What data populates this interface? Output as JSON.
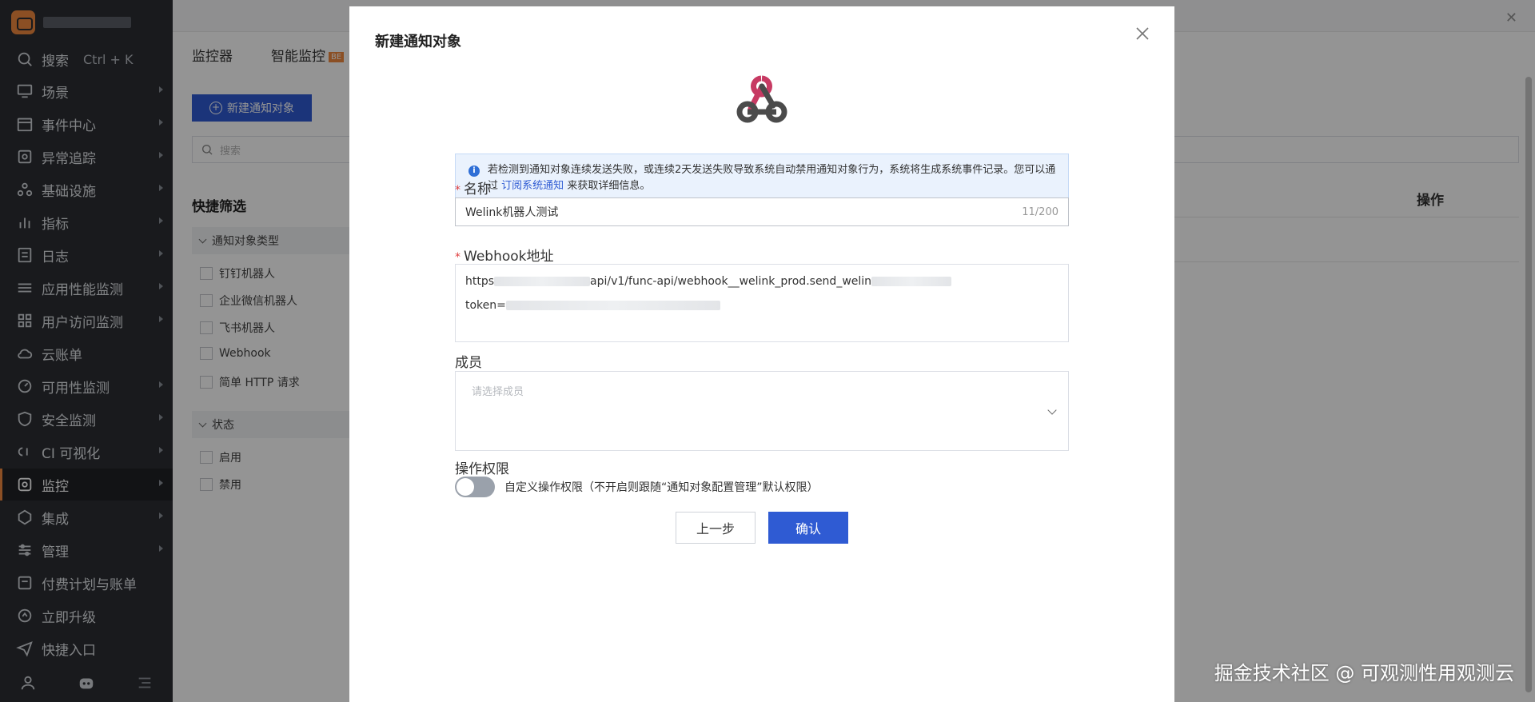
{
  "sidebar": {
    "search": {
      "label": "搜索",
      "shortcut": "Ctrl + K"
    },
    "items": [
      {
        "label": "场景",
        "icon": "monitor-icon"
      },
      {
        "label": "事件中心",
        "icon": "calendar-icon"
      },
      {
        "label": "异常追踪",
        "icon": "target-icon"
      },
      {
        "label": "基础设施",
        "icon": "nodes-icon"
      },
      {
        "label": "指标",
        "icon": "chart-icon"
      },
      {
        "label": "日志",
        "icon": "log-icon"
      },
      {
        "label": "应用性能监测",
        "icon": "sliders-icon"
      },
      {
        "label": "用户访问监测",
        "icon": "grid-icon"
      },
      {
        "label": "云账单",
        "icon": "cloud-icon"
      },
      {
        "label": "可用性监测",
        "icon": "gauge-icon"
      },
      {
        "label": "安全监测",
        "icon": "shield-icon"
      },
      {
        "label": "CI 可视化",
        "icon": "ci-icon"
      },
      {
        "label": "监控",
        "icon": "monitor-watch-icon"
      },
      {
        "label": "集成",
        "icon": "integration-icon"
      },
      {
        "label": "管理",
        "icon": "settings-icon"
      },
      {
        "label": "付费计划与账单",
        "icon": "bill-icon"
      },
      {
        "label": "立即升级",
        "icon": "upgrade-icon"
      },
      {
        "label": "快捷入口",
        "icon": "send-icon"
      }
    ]
  },
  "main": {
    "tabs": [
      {
        "label": "监控器"
      },
      {
        "label": "智能监控"
      }
    ],
    "beta": "BE",
    "new_button": "新建通知对象",
    "search_placeholder": "搜索",
    "filter_title": "快捷筛选",
    "group_type": "通知对象类型",
    "type_options": [
      "钉钉机器人",
      "企业微信机器人",
      "飞书机器人",
      "Webhook",
      "简单 HTTP 请求"
    ],
    "group_status": "状态",
    "status_options": [
      "启用",
      "禁用"
    ],
    "column_operation": "操作"
  },
  "modal": {
    "title": "新建通知对象",
    "info_text": "若检测到通知对象连续发送失败，或连续2天发送失败导致系统自动禁用通知对象行为，系统将生成系统事件记录。您可以通过",
    "info_link": "订阅系统通知",
    "info_suffix": "来获取详细信息。",
    "name_label": "名称",
    "name_value": "Welink机器人测试",
    "name_counter": "11/200",
    "webhook_label": "Webhook地址",
    "webhook_line1_prefix": "https",
    "webhook_line1_mid": "api/v1/func-api/webhook__welink_prod.send_welin",
    "webhook_line2_prefix": "token=",
    "member_label": "成员",
    "member_placeholder": "请选择成员",
    "permission_label": "操作权限",
    "permission_toggle_text": "自定义操作权限（不开启则跟随“通知对象配置管理”默认权限）",
    "permission_enabled": false,
    "prev_button": "上一步",
    "confirm_button": "确认"
  },
  "watermark": "掘金技术社区 @ 可观测性用观测云",
  "colors": {
    "primary": "#2f5bd3",
    "sidebar": "#2b2e33",
    "accent": "#f0883e"
  }
}
